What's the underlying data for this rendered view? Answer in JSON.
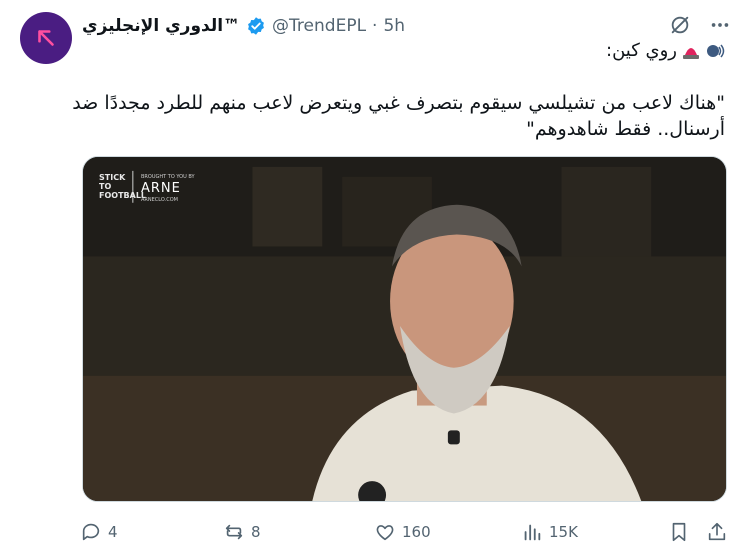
{
  "author": {
    "display_name": "الدوري الإنجليزي™",
    "handle": "@TrendEPL",
    "separator": "·",
    "time": "5h"
  },
  "tweet": {
    "intro_text": "روي كين:",
    "quote_text": "\"هناك لاعب من تشيلسي سيقوم بتصرف غبي ويتعرض لاعب منهم للطرد مجددًا ضد أرسنال.. فقط شاهدوهم\""
  },
  "media": {
    "logo_text": "STICK TO FOOTBALL",
    "brand_small": "BROUGHT TO YOU BY",
    "brand_name": "ARNE",
    "brand_url": "ARNECLO.COM"
  },
  "actions": {
    "replies": "4",
    "reposts": "8",
    "likes": "160",
    "views": "15K"
  },
  "colors": {
    "avatar_bg": "#4a1d82",
    "avatar_arrow": "#ff4fa0",
    "verified": "#1d9bf0",
    "muted": "#536471"
  }
}
